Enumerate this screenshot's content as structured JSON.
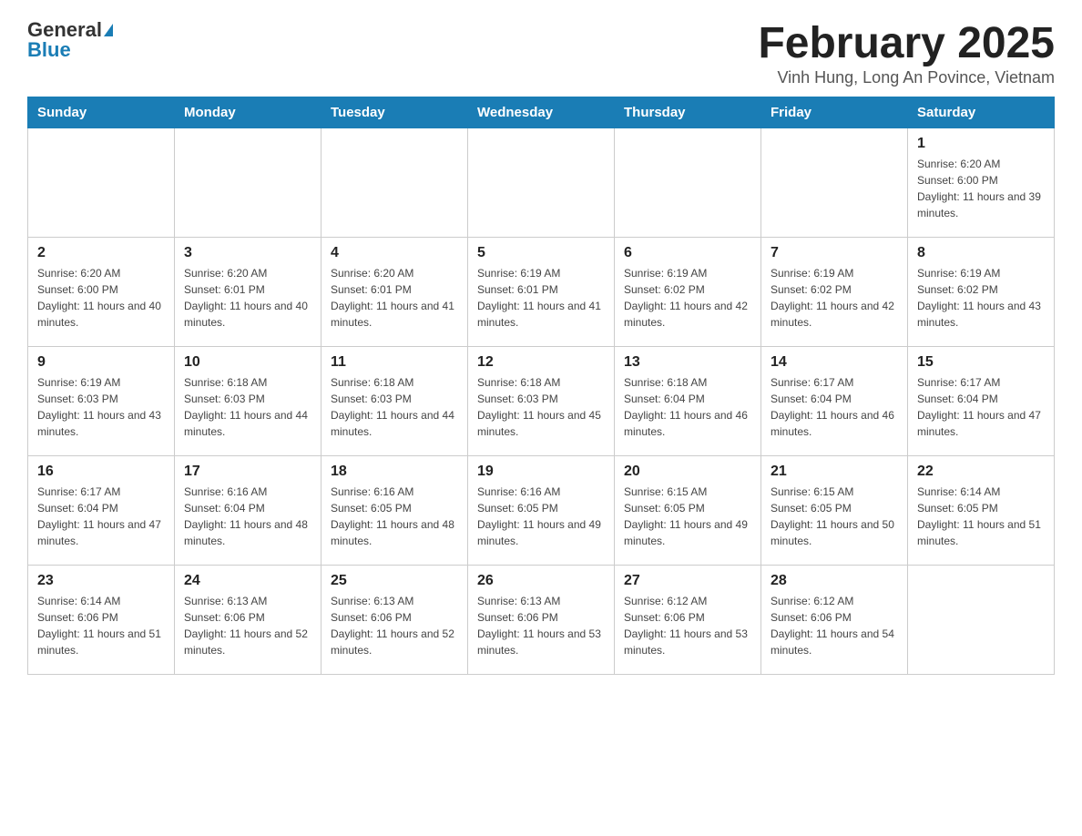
{
  "header": {
    "logo_general": "General",
    "logo_blue": "Blue",
    "month_title": "February 2025",
    "location": "Vinh Hung, Long An Povince, Vietnam"
  },
  "days_of_week": [
    "Sunday",
    "Monday",
    "Tuesday",
    "Wednesday",
    "Thursday",
    "Friday",
    "Saturday"
  ],
  "weeks": [
    [
      {
        "day": "",
        "info": ""
      },
      {
        "day": "",
        "info": ""
      },
      {
        "day": "",
        "info": ""
      },
      {
        "day": "",
        "info": ""
      },
      {
        "day": "",
        "info": ""
      },
      {
        "day": "",
        "info": ""
      },
      {
        "day": "1",
        "info": "Sunrise: 6:20 AM\nSunset: 6:00 PM\nDaylight: 11 hours and 39 minutes."
      }
    ],
    [
      {
        "day": "2",
        "info": "Sunrise: 6:20 AM\nSunset: 6:00 PM\nDaylight: 11 hours and 40 minutes."
      },
      {
        "day": "3",
        "info": "Sunrise: 6:20 AM\nSunset: 6:01 PM\nDaylight: 11 hours and 40 minutes."
      },
      {
        "day": "4",
        "info": "Sunrise: 6:20 AM\nSunset: 6:01 PM\nDaylight: 11 hours and 41 minutes."
      },
      {
        "day": "5",
        "info": "Sunrise: 6:19 AM\nSunset: 6:01 PM\nDaylight: 11 hours and 41 minutes."
      },
      {
        "day": "6",
        "info": "Sunrise: 6:19 AM\nSunset: 6:02 PM\nDaylight: 11 hours and 42 minutes."
      },
      {
        "day": "7",
        "info": "Sunrise: 6:19 AM\nSunset: 6:02 PM\nDaylight: 11 hours and 42 minutes."
      },
      {
        "day": "8",
        "info": "Sunrise: 6:19 AM\nSunset: 6:02 PM\nDaylight: 11 hours and 43 minutes."
      }
    ],
    [
      {
        "day": "9",
        "info": "Sunrise: 6:19 AM\nSunset: 6:03 PM\nDaylight: 11 hours and 43 minutes."
      },
      {
        "day": "10",
        "info": "Sunrise: 6:18 AM\nSunset: 6:03 PM\nDaylight: 11 hours and 44 minutes."
      },
      {
        "day": "11",
        "info": "Sunrise: 6:18 AM\nSunset: 6:03 PM\nDaylight: 11 hours and 44 minutes."
      },
      {
        "day": "12",
        "info": "Sunrise: 6:18 AM\nSunset: 6:03 PM\nDaylight: 11 hours and 45 minutes."
      },
      {
        "day": "13",
        "info": "Sunrise: 6:18 AM\nSunset: 6:04 PM\nDaylight: 11 hours and 46 minutes."
      },
      {
        "day": "14",
        "info": "Sunrise: 6:17 AM\nSunset: 6:04 PM\nDaylight: 11 hours and 46 minutes."
      },
      {
        "day": "15",
        "info": "Sunrise: 6:17 AM\nSunset: 6:04 PM\nDaylight: 11 hours and 47 minutes."
      }
    ],
    [
      {
        "day": "16",
        "info": "Sunrise: 6:17 AM\nSunset: 6:04 PM\nDaylight: 11 hours and 47 minutes."
      },
      {
        "day": "17",
        "info": "Sunrise: 6:16 AM\nSunset: 6:04 PM\nDaylight: 11 hours and 48 minutes."
      },
      {
        "day": "18",
        "info": "Sunrise: 6:16 AM\nSunset: 6:05 PM\nDaylight: 11 hours and 48 minutes."
      },
      {
        "day": "19",
        "info": "Sunrise: 6:16 AM\nSunset: 6:05 PM\nDaylight: 11 hours and 49 minutes."
      },
      {
        "day": "20",
        "info": "Sunrise: 6:15 AM\nSunset: 6:05 PM\nDaylight: 11 hours and 49 minutes."
      },
      {
        "day": "21",
        "info": "Sunrise: 6:15 AM\nSunset: 6:05 PM\nDaylight: 11 hours and 50 minutes."
      },
      {
        "day": "22",
        "info": "Sunrise: 6:14 AM\nSunset: 6:05 PM\nDaylight: 11 hours and 51 minutes."
      }
    ],
    [
      {
        "day": "23",
        "info": "Sunrise: 6:14 AM\nSunset: 6:06 PM\nDaylight: 11 hours and 51 minutes."
      },
      {
        "day": "24",
        "info": "Sunrise: 6:13 AM\nSunset: 6:06 PM\nDaylight: 11 hours and 52 minutes."
      },
      {
        "day": "25",
        "info": "Sunrise: 6:13 AM\nSunset: 6:06 PM\nDaylight: 11 hours and 52 minutes."
      },
      {
        "day": "26",
        "info": "Sunrise: 6:13 AM\nSunset: 6:06 PM\nDaylight: 11 hours and 53 minutes."
      },
      {
        "day": "27",
        "info": "Sunrise: 6:12 AM\nSunset: 6:06 PM\nDaylight: 11 hours and 53 minutes."
      },
      {
        "day": "28",
        "info": "Sunrise: 6:12 AM\nSunset: 6:06 PM\nDaylight: 11 hours and 54 minutes."
      },
      {
        "day": "",
        "info": ""
      }
    ]
  ]
}
